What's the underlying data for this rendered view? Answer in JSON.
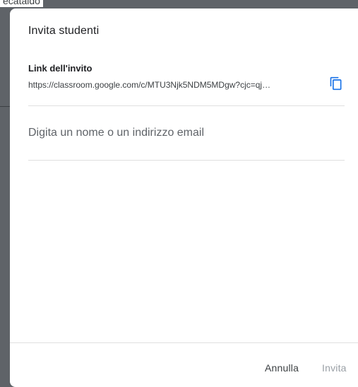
{
  "background": {
    "partial_text": "ecataldo"
  },
  "dialog": {
    "title": "Invita studenti",
    "invite_link": {
      "label": "Link dell'invito",
      "url": "https://classroom.google.com/c/MTU3Njk5NDM5MDgw?cjc=qj…",
      "copy_icon": "copy-icon"
    },
    "search": {
      "placeholder": "Digita un nome o un indirizzo email",
      "value": ""
    },
    "footer": {
      "cancel_label": "Annulla",
      "invite_label": "Invita"
    }
  },
  "colors": {
    "accent": "#1a73e8",
    "text_primary": "#202124",
    "text_secondary": "#3c4043",
    "disabled": "#9aa0a6",
    "divider": "#e0e0e0"
  }
}
